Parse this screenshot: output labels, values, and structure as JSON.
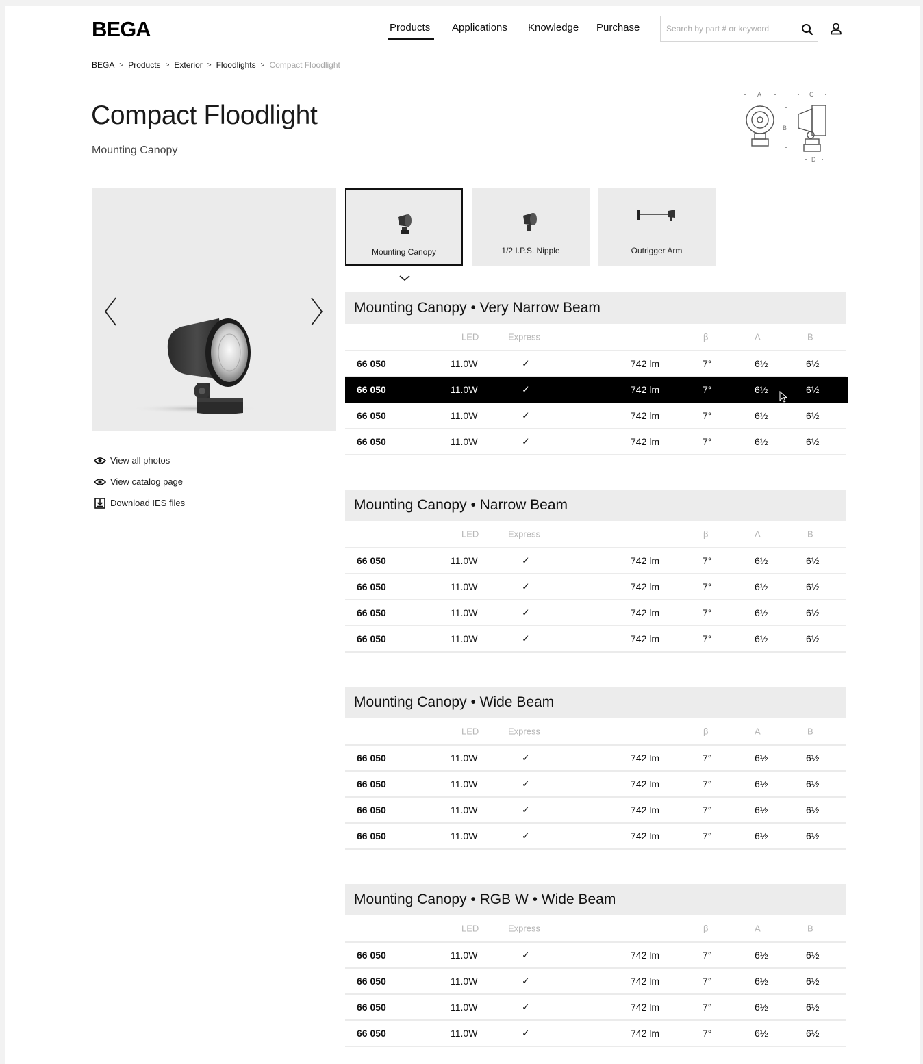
{
  "header": {
    "logo": "BEGA",
    "nav": [
      "Products",
      "Applications",
      "Knowledge",
      "Purchase"
    ],
    "search_placeholder": "Search by part # or keyword"
  },
  "breadcrumb": [
    "BEGA",
    "Products",
    "Exterior",
    "Floodlights",
    "Compact Floodlight"
  ],
  "breadcrumb_separator": ">",
  "product": {
    "title": "Compact Floodlight",
    "subtitle": "Mounting Canopy"
  },
  "diagram_labels": {
    "a": "A",
    "b": "B",
    "c": "C",
    "d": "D"
  },
  "links": [
    "View all photos",
    "View catalog page",
    "Download IES files"
  ],
  "mount_tabs": [
    "Mounting Canopy",
    "1/2 I.P.S. Nipple",
    "Outrigger Arm"
  ],
  "table_headers": {
    "led": "LED",
    "express": "Express",
    "beta": "β",
    "a": "A",
    "b": "B"
  },
  "sections": [
    {
      "title": "Mounting Canopy • Very Narrow Beam",
      "rows": [
        {
          "part": "66 050",
          "led": "11.0W",
          "express": "✓",
          "lm": "742 lm",
          "beta": "7°",
          "a": "6½",
          "b": "6½"
        },
        {
          "part": "66 050",
          "led": "11.0W",
          "express": "✓",
          "lm": "742 lm",
          "beta": "7°",
          "a": "6½",
          "b": "6½"
        },
        {
          "part": "66 050",
          "led": "11.0W",
          "express": "✓",
          "lm": "742 lm",
          "beta": "7°",
          "a": "6½",
          "b": "6½"
        },
        {
          "part": "66 050",
          "led": "11.0W",
          "express": "✓",
          "lm": "742 lm",
          "beta": "7°",
          "a": "6½",
          "b": "6½"
        }
      ]
    },
    {
      "title": "Mounting Canopy • Narrow Beam",
      "rows": [
        {
          "part": "66 050",
          "led": "11.0W",
          "express": "✓",
          "lm": "742 lm",
          "beta": "7°",
          "a": "6½",
          "b": "6½"
        },
        {
          "part": "66 050",
          "led": "11.0W",
          "express": "✓",
          "lm": "742 lm",
          "beta": "7°",
          "a": "6½",
          "b": "6½"
        },
        {
          "part": "66 050",
          "led": "11.0W",
          "express": "✓",
          "lm": "742 lm",
          "beta": "7°",
          "a": "6½",
          "b": "6½"
        },
        {
          "part": "66 050",
          "led": "11.0W",
          "express": "✓",
          "lm": "742 lm",
          "beta": "7°",
          "a": "6½",
          "b": "6½"
        }
      ]
    },
    {
      "title": "Mounting Canopy • Wide Beam",
      "rows": [
        {
          "part": "66 050",
          "led": "11.0W",
          "express": "✓",
          "lm": "742 lm",
          "beta": "7°",
          "a": "6½",
          "b": "6½"
        },
        {
          "part": "66 050",
          "led": "11.0W",
          "express": "✓",
          "lm": "742 lm",
          "beta": "7°",
          "a": "6½",
          "b": "6½"
        },
        {
          "part": "66 050",
          "led": "11.0W",
          "express": "✓",
          "lm": "742 lm",
          "beta": "7°",
          "a": "6½",
          "b": "6½"
        },
        {
          "part": "66 050",
          "led": "11.0W",
          "express": "✓",
          "lm": "742 lm",
          "beta": "7°",
          "a": "6½",
          "b": "6½"
        }
      ]
    },
    {
      "title": "Mounting Canopy • RGB W • Wide Beam",
      "rows": [
        {
          "part": "66 050",
          "led": "11.0W",
          "express": "✓",
          "lm": "742 lm",
          "beta": "7°",
          "a": "6½",
          "b": "6½"
        },
        {
          "part": "66 050",
          "led": "11.0W",
          "express": "✓",
          "lm": "742 lm",
          "beta": "7°",
          "a": "6½",
          "b": "6½"
        },
        {
          "part": "66 050",
          "led": "11.0W",
          "express": "✓",
          "lm": "742 lm",
          "beta": "7°",
          "a": "6½",
          "b": "6½"
        },
        {
          "part": "66 050",
          "led": "11.0W",
          "express": "✓",
          "lm": "742 lm",
          "beta": "7°",
          "a": "6½",
          "b": "6½"
        }
      ]
    }
  ],
  "icons": {
    "search": "search-icon",
    "user": "user-icon",
    "eye": "eye-icon",
    "download": "download-icon",
    "prev": "chevron-left-icon",
    "next": "chevron-right-icon",
    "collapse": "chevron-down-icon"
  },
  "colors": {
    "highlight_row": "#000000",
    "section_band": "#ececec",
    "image_bg": "#ebebeb"
  }
}
